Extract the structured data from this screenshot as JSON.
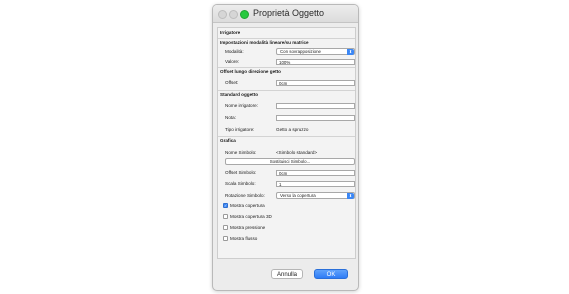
{
  "window": {
    "title": "Proprietà Oggetto"
  },
  "section": "Irrigatore",
  "modal": {
    "heading": "Impostazioni modalità lineare/su matrice",
    "mode_label": "Modalità:",
    "mode_value": "Con sovrapposizione",
    "value_label": "Valore:",
    "value_value": "100%"
  },
  "offset_dir": {
    "heading": "Offset lungo direzione getto",
    "offset_label": "Offset:",
    "offset_value": "0cm"
  },
  "standard": {
    "heading": "Standard oggetto",
    "name_label": "Nome irrigatore:",
    "name_value": "",
    "note_label": "Nota:",
    "note_value": "",
    "type_label": "Tipo irrigatore:",
    "type_value": "Getto a spruzzo"
  },
  "graphics": {
    "heading": "Grafica",
    "symbol_name_label": "Nome Simbolo:",
    "symbol_name_value": "<Simbolo standard>",
    "replace_button": "Sostituisci Simbolo...",
    "symbol_offset_label": "Offset Simbolo:",
    "symbol_offset_value": "0cm",
    "symbol_scale_label": "Scala Simbolo:",
    "symbol_scale_value": "1",
    "symbol_rotation_label": "Rotazione Simbolo:",
    "symbol_rotation_value": "Verso la copertura",
    "checkboxes": [
      {
        "label": "Mostra copertura",
        "checked": true
      },
      {
        "label": "Mostra copertura 3D",
        "checked": false
      },
      {
        "label": "Mostra pressione",
        "checked": false
      },
      {
        "label": "Mostra flusso",
        "checked": false
      }
    ]
  },
  "footer": {
    "cancel": "Annulla",
    "ok": "OK"
  },
  "colors": {
    "accent": "#3b87f5",
    "window_bg": "#ececec",
    "zoom_button": "#27c93f"
  }
}
